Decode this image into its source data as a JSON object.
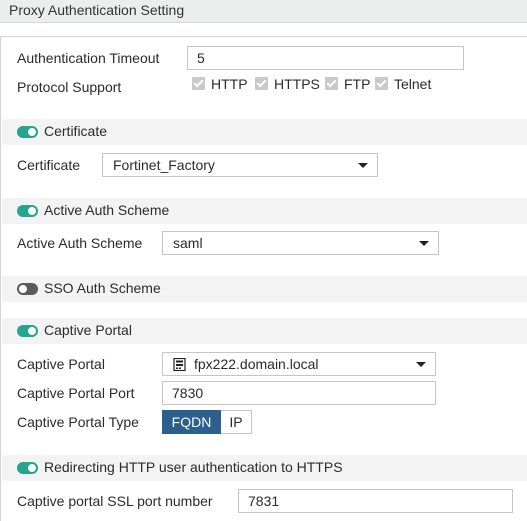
{
  "title": "Proxy Authentication Setting",
  "auth_timeout": {
    "label": "Authentication Timeout",
    "value": "5"
  },
  "protocol_support": {
    "label": "Protocol Support",
    "options": [
      {
        "label": "HTTP",
        "checked": true
      },
      {
        "label": "HTTPS",
        "checked": true
      },
      {
        "label": "FTP",
        "checked": true
      },
      {
        "label": "Telnet",
        "checked": true
      }
    ]
  },
  "certificate_section": {
    "title": "Certificate",
    "enabled": true,
    "field_label": "Certificate",
    "value": "Fortinet_Factory"
  },
  "active_auth_section": {
    "title": "Active Auth Scheme",
    "enabled": true,
    "field_label": "Active Auth Scheme",
    "value": "saml"
  },
  "sso_section": {
    "title": "SSO Auth Scheme",
    "enabled": false
  },
  "captive_portal_section": {
    "title": "Captive Portal",
    "enabled": true,
    "portal_label": "Captive Portal",
    "portal_value": "fpx222.domain.local",
    "port_label": "Captive Portal Port",
    "port_value": "7830",
    "type_label": "Captive Portal Type",
    "type_options": [
      "FQDN",
      "IP"
    ],
    "type_selected": "FQDN"
  },
  "redirect_section": {
    "title": "Redirecting HTTP user authentication to HTTPS",
    "enabled": true,
    "ssl_port_label": "Captive portal SSL port number",
    "ssl_port_value": "7831"
  },
  "colors": {
    "toggle_on": "#25a58e",
    "toggle_off": "#5b5b5b",
    "segment_active": "#2a5f8e"
  },
  "icons": {
    "server": "server-icon",
    "dropdown": "chevron-down-icon",
    "check": "checkbox-checked-icon"
  }
}
